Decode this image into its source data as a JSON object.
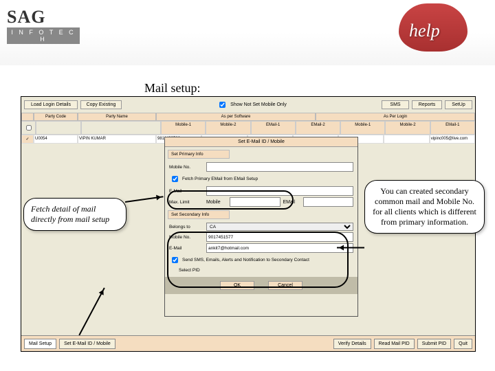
{
  "header": {
    "logo_top": "SAG",
    "logo_bottom": "I N F O T E C H",
    "help": "help"
  },
  "title": "Mail setup:",
  "toolbar": {
    "load": "Load Login Details",
    "copy": "Copy Existing",
    "show_not_set": "Show Not Set Mobile Only",
    "sms": "SMS",
    "reports": "Reports",
    "setup": "SetUp"
  },
  "grid": {
    "party_code": "Party Code",
    "party_name": "Party Name",
    "as_software": "As per Software",
    "as_login": "As Per Login",
    "mobile1": "Mobile-1",
    "mobile2": "Mobile-2",
    "email1": "EMail-1",
    "email2": "EMail-2",
    "row": {
      "chk": "✓",
      "code": "U0054",
      "name": "VIPIN KUMAR",
      "m1": "9811433566",
      "email_login": "vipinc005@live.com"
    }
  },
  "dialog": {
    "title": "Set E-Mail ID / Mobile",
    "primary": "Set Primary Info",
    "mobile": "Mobile No.",
    "fetch_chk": "Fetch Primary EMail from EMail Setup",
    "email": "E-Mail",
    "max_limit": "Max. Limit",
    "mobile_lbl": "Mobile",
    "email_lbl": "EMail",
    "secondary": "Set Secondary Info",
    "belongs": "Belongs to",
    "belongs_val": "CA",
    "mobile_val2": "9017451577",
    "email_val2": "ankit7@hotmail.com",
    "send_chk": "Send SMS, Emails, Alerts and Notification to Secondary Contact",
    "select": "Select PID",
    "ok": "OK",
    "cancel": "Cancel"
  },
  "bottom": {
    "mail_setup": "Mail Setup",
    "set_email": "Set E-Mail ID / Mobile",
    "verify": "Verify Details",
    "read": "Read Mail PID",
    "submit": "Submit PID",
    "quit": "Quit"
  },
  "callouts": {
    "left": "Fetch detail of mail directly from mail setup",
    "right": "You can created secondary common mail and Mobile No. for all clients which is different from primary information."
  }
}
